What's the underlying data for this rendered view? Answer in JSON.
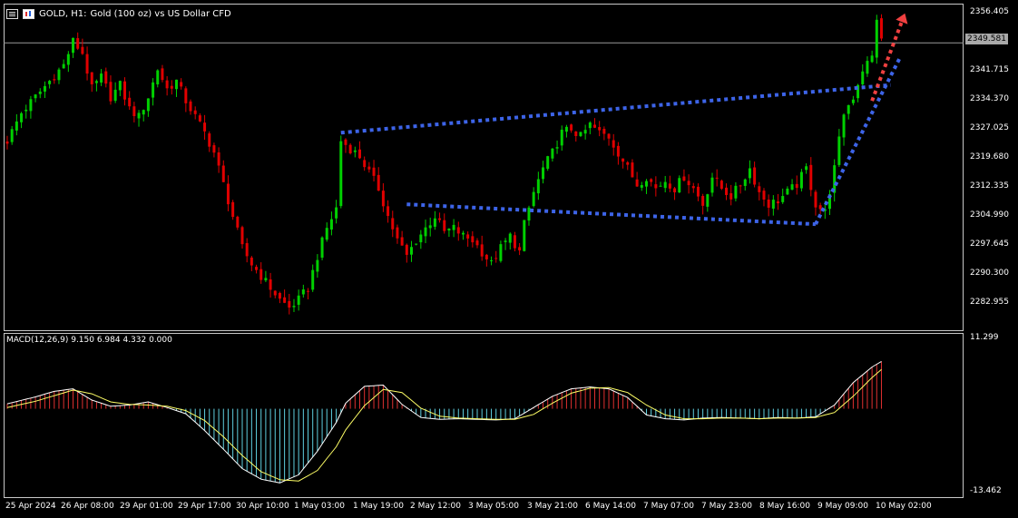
{
  "chart_title": {
    "symbol_text": "GOLD, H1:",
    "description": "Gold (100 oz) vs US Dollar CFD",
    "menu_icon": "chart-menu-icon",
    "chart_icon": "chart-type-icon"
  },
  "current_price_label": "2349.581",
  "chart_data": [
    {
      "type": "candlestick",
      "title": "GOLD, H1:  Gold (100 oz) vs US Dollar CFD",
      "xlabel": "",
      "ylabel": "",
      "ylim": [
        2277.8,
        2359.0
      ],
      "grid": false,
      "y_tick_labels": [
        "2356.405",
        "2349.581",
        "2341.715",
        "2334.370",
        "2327.025",
        "2319.680",
        "2312.335",
        "2304.990",
        "2297.645",
        "2290.300",
        "2282.955"
      ],
      "y_tick_values": [
        2356.405,
        2341.715,
        2334.37,
        2327.025,
        2319.68,
        2312.335,
        2304.99,
        2297.645,
        2290.3,
        2282.955
      ],
      "x_tick_labels": [
        "25 Apr 2024",
        "26 Apr 08:00",
        "29 Apr 01:00",
        "29 Apr 17:00",
        "30 Apr 10:00",
        "1 May 03:00",
        "1 May 19:00",
        "2 May 12:00",
        "3 May 05:00",
        "3 May 21:00",
        "6 May 14:00",
        "7 May 07:00",
        "7 May 23:00",
        "8 May 16:00",
        "9 May 09:00",
        "10 May 02:00"
      ],
      "bull_color": "#00d000",
      "bear_color": "#e00000",
      "current_price": 2349.581,
      "close_path": [
        [
          0,
          2325
        ],
        [
          3,
          2332
        ],
        [
          6,
          2336
        ],
        [
          9,
          2340
        ],
        [
          12,
          2344
        ],
        [
          14,
          2350
        ],
        [
          16,
          2347
        ],
        [
          18,
          2338
        ],
        [
          20,
          2341
        ],
        [
          22,
          2336
        ],
        [
          24,
          2339
        ],
        [
          26,
          2333
        ],
        [
          28,
          2331
        ],
        [
          30,
          2336
        ],
        [
          32,
          2343
        ],
        [
          34,
          2338
        ],
        [
          36,
          2340
        ],
        [
          38,
          2335
        ],
        [
          40,
          2331
        ],
        [
          42,
          2327
        ],
        [
          44,
          2322
        ],
        [
          46,
          2314
        ],
        [
          48,
          2306
        ],
        [
          50,
          2298
        ],
        [
          52,
          2294
        ],
        [
          54,
          2291
        ],
        [
          56,
          2288
        ],
        [
          58,
          2285
        ],
        [
          60,
          2283
        ],
        [
          62,
          2285
        ],
        [
          64,
          2288
        ],
        [
          66,
          2296
        ],
        [
          68,
          2303
        ],
        [
          70,
          2308
        ],
        [
          71,
          2325
        ],
        [
          73,
          2323
        ],
        [
          75,
          2321
        ],
        [
          77,
          2317
        ],
        [
          79,
          2313
        ],
        [
          81,
          2306
        ],
        [
          83,
          2300
        ],
        [
          85,
          2296
        ],
        [
          87,
          2300
        ],
        [
          89,
          2303
        ],
        [
          91,
          2306
        ],
        [
          93,
          2302
        ],
        [
          95,
          2303
        ],
        [
          97,
          2301
        ],
        [
          99,
          2300
        ],
        [
          101,
          2297
        ],
        [
          103,
          2294
        ],
        [
          105,
          2298
        ],
        [
          107,
          2301
        ],
        [
          109,
          2297
        ],
        [
          110,
          2304
        ],
        [
          112,
          2312
        ],
        [
          114,
          2318
        ],
        [
          116,
          2322
        ],
        [
          118,
          2327
        ],
        [
          120,
          2328
        ],
        [
          122,
          2326
        ],
        [
          124,
          2329
        ],
        [
          126,
          2327
        ],
        [
          128,
          2326
        ],
        [
          130,
          2322
        ],
        [
          132,
          2318
        ],
        [
          134,
          2314
        ],
        [
          136,
          2316
        ],
        [
          138,
          2313
        ],
        [
          140,
          2315
        ],
        [
          142,
          2313
        ],
        [
          144,
          2316
        ],
        [
          146,
          2313
        ],
        [
          148,
          2309
        ],
        [
          150,
          2316
        ],
        [
          152,
          2313
        ],
        [
          154,
          2311
        ],
        [
          156,
          2314
        ],
        [
          158,
          2318
        ],
        [
          160,
          2312
        ],
        [
          162,
          2309
        ],
        [
          164,
          2310
        ],
        [
          166,
          2312
        ],
        [
          168,
          2314
        ],
        [
          170,
          2318
        ],
        [
          172,
          2309
        ],
        [
          174,
          2307
        ],
        [
          176,
          2318
        ],
        [
          178,
          2332
        ],
        [
          180,
          2336
        ],
        [
          182,
          2343
        ],
        [
          184,
          2346
        ],
        [
          185,
          2356
        ],
        [
          186,
          2350
        ]
      ],
      "patterns": {
        "upper_channel_line": [
          [
            71,
            2327
          ],
          [
            188,
            2339
          ]
        ],
        "lower_channel_line": [
          [
            85,
            2309
          ],
          [
            172,
            2304
          ]
        ],
        "rising_line": [
          [
            172,
            2304
          ],
          [
            190,
            2346
          ]
        ],
        "projected_arrow": [
          [
            184,
            2335
          ],
          [
            191,
            2357
          ]
        ]
      }
    },
    {
      "type": "macd",
      "title": "MACD(12,26,9) 9.150 6.984 4.332 0.000",
      "label_text": "MACD(12,26,9) 9.150 6.984 4.332 0.000",
      "params": [
        12,
        26,
        9
      ],
      "macd_value": 9.15,
      "signal_value": 6.984,
      "osma_value": 4.332,
      "ylim": [
        -13.462,
        11.299
      ],
      "y_tick_labels": [
        "11.299",
        "-13.462"
      ],
      "macd_color": "#ffffff",
      "signal_color": "#ffff66",
      "positive_hist_color": "#e03030",
      "negative_hist_color": "#5fd0e0",
      "macd": [
        [
          0,
          0.8
        ],
        [
          6,
          1.9
        ],
        [
          10,
          2.8
        ],
        [
          14,
          3.2
        ],
        [
          18,
          1.4
        ],
        [
          22,
          0.4
        ],
        [
          26,
          0.6
        ],
        [
          30,
          1.1
        ],
        [
          34,
          0.2
        ],
        [
          38,
          -0.8
        ],
        [
          42,
          -3.5
        ],
        [
          46,
          -6.5
        ],
        [
          50,
          -9.6
        ],
        [
          54,
          -11.3
        ],
        [
          58,
          -11.9
        ],
        [
          62,
          -10.6
        ],
        [
          66,
          -6.8
        ],
        [
          70,
          -2.2
        ],
        [
          72,
          0.9
        ],
        [
          76,
          3.6
        ],
        [
          80,
          3.8
        ],
        [
          84,
          0.7
        ],
        [
          88,
          -1.4
        ],
        [
          92,
          -1.7
        ],
        [
          96,
          -1.6
        ],
        [
          100,
          -1.7
        ],
        [
          104,
          -1.8
        ],
        [
          108,
          -1.6
        ],
        [
          112,
          0.2
        ],
        [
          116,
          2.0
        ],
        [
          120,
          3.2
        ],
        [
          124,
          3.5
        ],
        [
          128,
          3.2
        ],
        [
          132,
          1.8
        ],
        [
          136,
          -1.0
        ],
        [
          140,
          -1.6
        ],
        [
          144,
          -1.8
        ],
        [
          148,
          -1.5
        ],
        [
          152,
          -1.4
        ],
        [
          156,
          -1.5
        ],
        [
          160,
          -1.6
        ],
        [
          164,
          -1.4
        ],
        [
          168,
          -1.5
        ],
        [
          172,
          -1.3
        ],
        [
          176,
          0.6
        ],
        [
          180,
          4.2
        ],
        [
          184,
          6.7
        ],
        [
          186,
          7.6
        ]
      ],
      "signal": [
        [
          0,
          0.2
        ],
        [
          6,
          1.2
        ],
        [
          10,
          2.1
        ],
        [
          14,
          3.0
        ],
        [
          18,
          2.4
        ],
        [
          22,
          1.1
        ],
        [
          26,
          0.7
        ],
        [
          30,
          0.6
        ],
        [
          34,
          0.4
        ],
        [
          38,
          -0.3
        ],
        [
          42,
          -1.9
        ],
        [
          46,
          -4.5
        ],
        [
          50,
          -7.5
        ],
        [
          54,
          -10.1
        ],
        [
          58,
          -11.4
        ],
        [
          62,
          -11.6
        ],
        [
          66,
          -9.9
        ],
        [
          70,
          -6.1
        ],
        [
          72,
          -3.4
        ],
        [
          76,
          0.5
        ],
        [
          80,
          3.1
        ],
        [
          84,
          2.6
        ],
        [
          88,
          0.1
        ],
        [
          92,
          -1.2
        ],
        [
          96,
          -1.5
        ],
        [
          100,
          -1.6
        ],
        [
          104,
          -1.7
        ],
        [
          108,
          -1.7
        ],
        [
          112,
          -0.9
        ],
        [
          116,
          0.9
        ],
        [
          120,
          2.5
        ],
        [
          124,
          3.3
        ],
        [
          128,
          3.4
        ],
        [
          132,
          2.6
        ],
        [
          136,
          0.6
        ],
        [
          140,
          -1.0
        ],
        [
          144,
          -1.6
        ],
        [
          148,
          -1.6
        ],
        [
          152,
          -1.5
        ],
        [
          156,
          -1.5
        ],
        [
          160,
          -1.6
        ],
        [
          164,
          -1.5
        ],
        [
          168,
          -1.5
        ],
        [
          172,
          -1.4
        ],
        [
          176,
          -0.6
        ],
        [
          180,
          2.0
        ],
        [
          184,
          5.0
        ],
        [
          186,
          6.3
        ]
      ]
    }
  ]
}
